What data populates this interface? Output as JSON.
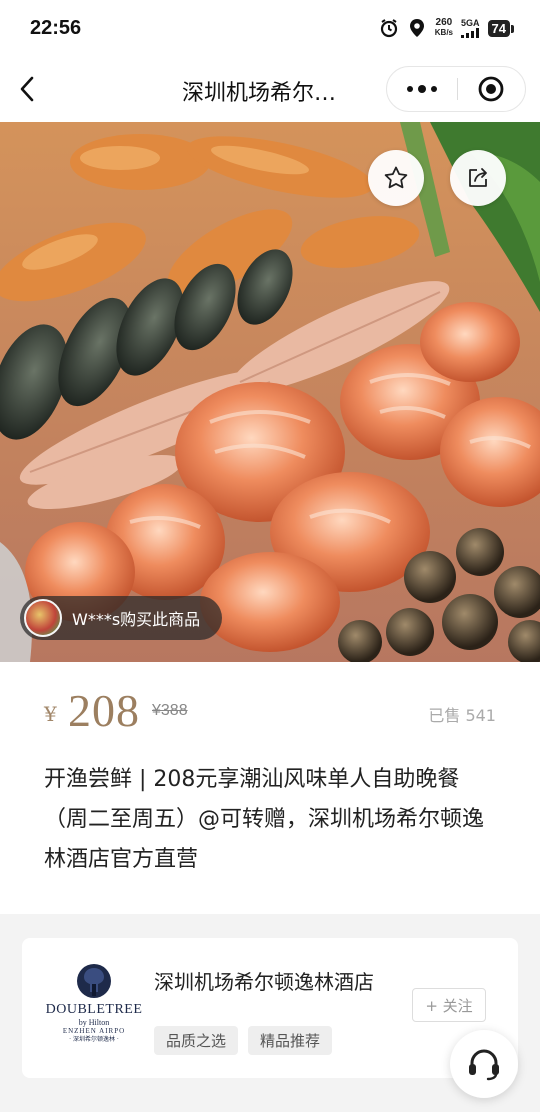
{
  "status_bar": {
    "time": "22:56",
    "net_speed": "260",
    "net_unit": "KB/s",
    "network": "5GA",
    "battery": "74"
  },
  "nav": {
    "title": "深圳机场希尔…"
  },
  "hero": {
    "buyer_text": "W***s购买此商品"
  },
  "product": {
    "currency": "¥",
    "price": "208",
    "original_price": "¥388",
    "sold": "已售 541",
    "title": "开渔尝鲜 | 208元享潮汕风味单人自助晚餐（周二至周五）@可转赠，深圳机场希尔顿逸林酒店官方直营"
  },
  "shop": {
    "logo_word": "DOUBLETREE",
    "logo_sub": "by Hilton",
    "logo_sub2": "ENZHEN AIRPO",
    "logo_cn": "· 深圳希尔顿逸林 ·",
    "name": "深圳机场希尔顿逸林酒店",
    "follow": "+ 关注",
    "tags": [
      "品质之选",
      "精品推荐"
    ]
  },
  "colors": {
    "price": "#9c7f60",
    "logo_navy": "#1e2a4a"
  }
}
